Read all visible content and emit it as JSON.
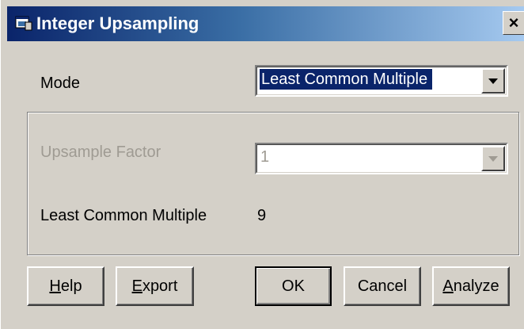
{
  "window": {
    "title": "Integer Upsampling",
    "close_glyph": "×",
    "icon": "dialog-app-icon"
  },
  "mode": {
    "label": "Mode",
    "selected": "Least Common Multiple"
  },
  "upsample_factor": {
    "label": "Upsample Factor",
    "value": "1",
    "enabled": false
  },
  "least_common_multiple": {
    "label": "Least Common Multiple",
    "value": "9"
  },
  "buttons": {
    "help": {
      "mnemonic": "H",
      "rest": "elp"
    },
    "export": {
      "mnemonic": "E",
      "rest": "xport"
    },
    "ok": "OK",
    "cancel": "Cancel",
    "analyze": {
      "mnemonic": "A",
      "rest": "nalyze"
    }
  },
  "colors": {
    "title_gradient_start": "#0a246a",
    "title_gradient_end": "#a6caf0",
    "face": "#d4d0c8",
    "disabled_text": "#9f9b93"
  }
}
